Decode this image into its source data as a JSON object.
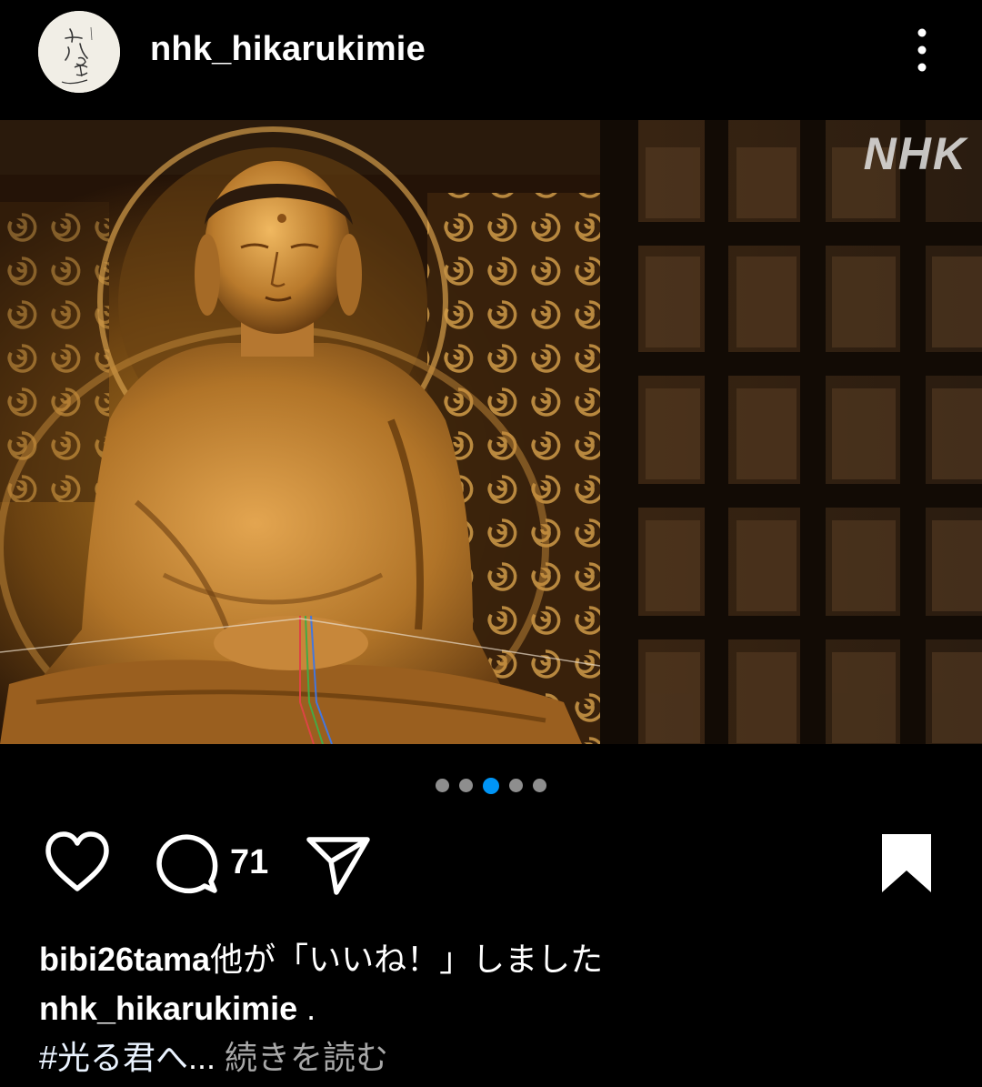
{
  "header": {
    "username": "nhk_hikarukimie",
    "avatar_icon": "calligraphy-avatar-icon",
    "more_icon": "more-vertical-icon"
  },
  "media": {
    "watermark": "NHK",
    "description_icon": "golden-buddha-photo",
    "carousel": {
      "total": 5,
      "active_index": 2
    }
  },
  "actions": {
    "like_icon": "heart-icon",
    "comment_icon": "comment-bubble-icon",
    "comment_count": "71",
    "share_icon": "send-icon",
    "save_icon": "bookmark-filled-icon"
  },
  "caption": {
    "likes_user": "bibi26tama",
    "likes_suffix": "他が「いいね！」しました",
    "author": "nhk_hikarukimie",
    "author_text": " .",
    "hashtag": "#光る君へ",
    "ellipsis": "... ",
    "more_label": "続きを読む"
  },
  "colors": {
    "background": "#000000",
    "accent_dot": "#0095f6",
    "inactive_dot": "#8e8e8e",
    "muted_text": "#a8a8a8"
  }
}
